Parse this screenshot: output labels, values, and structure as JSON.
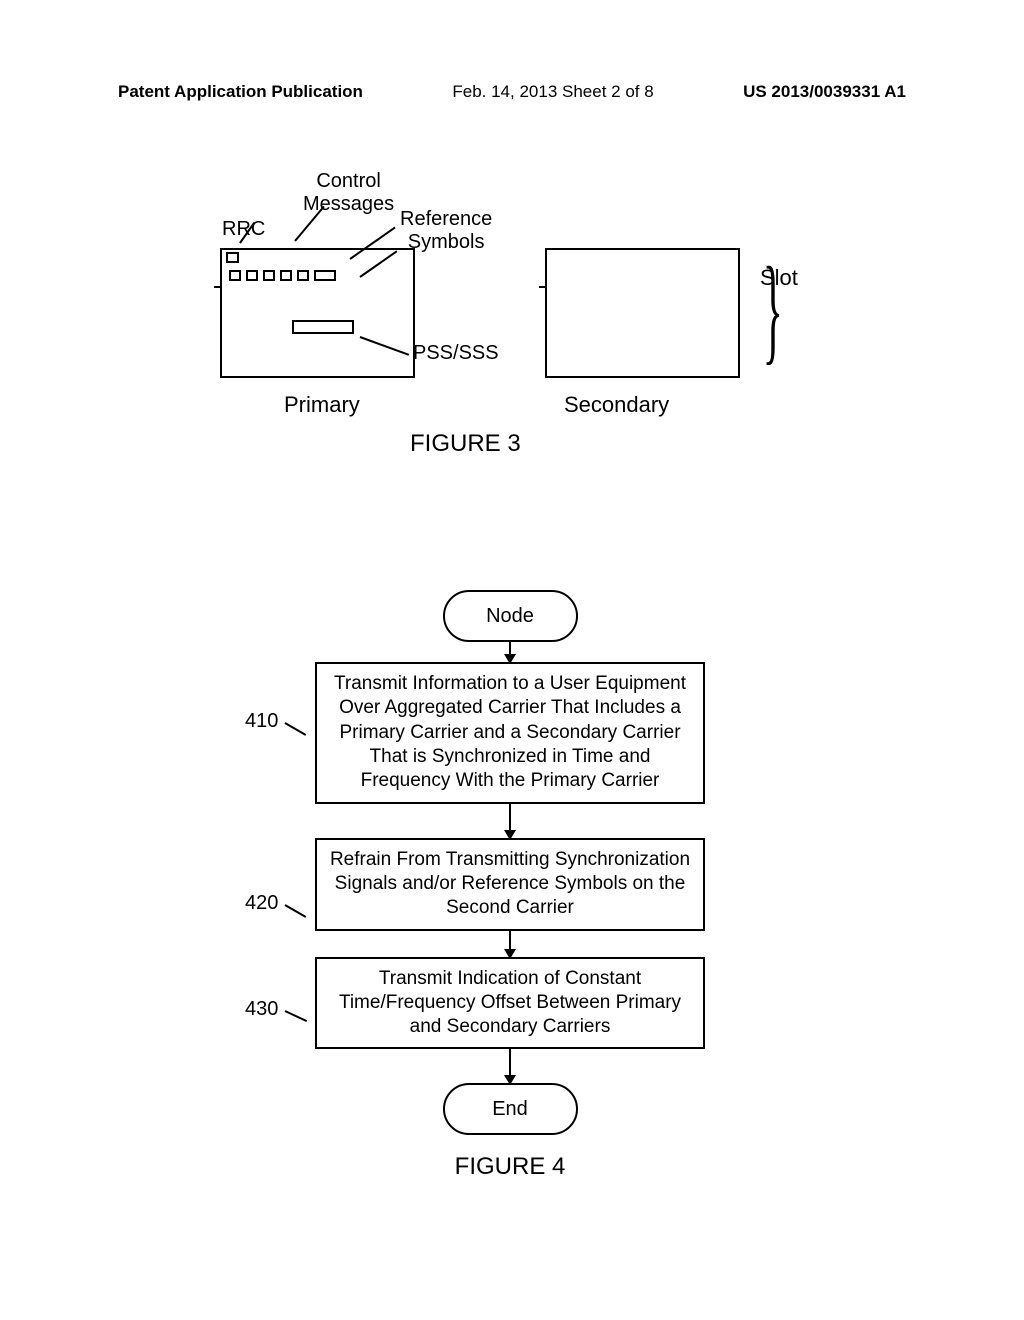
{
  "header": {
    "left": "Patent Application Publication",
    "middle": "Feb. 14, 2013  Sheet 2 of 8",
    "right": "US 2013/0039331 A1"
  },
  "figure3": {
    "labels": {
      "control_messages": "Control\nMessages",
      "rrc": "RRC",
      "reference_symbols": "Reference\nSymbols",
      "pss_sss": "PSS/SSS",
      "slot": "Slot",
      "primary": "Primary",
      "secondary": "Secondary"
    },
    "caption": "FIGURE 3"
  },
  "figure4": {
    "start": "Node",
    "steps": [
      {
        "ref": "410",
        "text": "Transmit Information to a User Equipment Over Aggregated Carrier That Includes a Primary Carrier and a Secondary Carrier That is Synchronized in Time and Frequency With the Primary Carrier"
      },
      {
        "ref": "420",
        "text": "Refrain From Transmitting Synchronization Signals and/or Reference Symbols on the Second Carrier"
      },
      {
        "ref": "430",
        "text": "Transmit Indication of Constant Time/Frequency Offset Between Primary and Secondary Carriers"
      }
    ],
    "end": "End",
    "caption": "FIGURE 4"
  }
}
